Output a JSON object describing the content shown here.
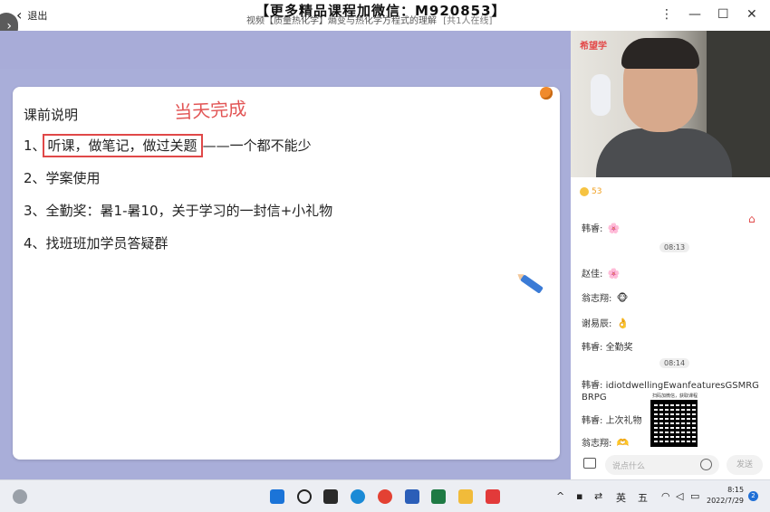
{
  "header": {
    "back_label": "退出",
    "watermark": "【更多精品课程加微信：M920853】",
    "title": "视频【质量热化学】熵变与热化学方程式的理解",
    "online": "[共1人在线]"
  },
  "board": {
    "heading": "课前说明",
    "handwriting": "当天完成",
    "items": [
      {
        "num": "1、",
        "highlight": "听课，做笔记，做过关题",
        "rest": "——一个都不能少"
      },
      {
        "num": "2、",
        "text": "学案使用"
      },
      {
        "num": "3、",
        "text": "全勤奖：暑1-暑10，关于学习的一封信+小礼物"
      },
      {
        "num": "4、",
        "text": "找班班加学员答疑群"
      }
    ]
  },
  "video": {
    "logo": "希望学"
  },
  "likes": "53",
  "chat": {
    "messages": [
      {
        "name": "韩睿:",
        "text": "🌸"
      },
      {
        "time": "08:13"
      },
      {
        "name": "赵佳:",
        "text": "🌸"
      },
      {
        "name": "翁志翔:",
        "text": "🐵"
      },
      {
        "name": "谢易辰:",
        "text": "👌"
      },
      {
        "name": "韩睿:",
        "text": "全勤奖"
      },
      {
        "time": "08:14"
      },
      {
        "name": "韩睿:",
        "text": "idiotdwellingEwanfeaturesGSMRGBRPG"
      },
      {
        "name": "韩睿:",
        "text": "上次礼物"
      },
      {
        "name": "翁志翔:",
        "text": "🫶"
      }
    ],
    "qr_caption": "扫码加微信，获取课程",
    "input_placeholder": "说点什么",
    "send_label": "发送"
  },
  "taskbar": {
    "tray_lang": "英",
    "tray_ime": "五",
    "time": "8:15",
    "date": "2022/7/29",
    "notifications": "2"
  }
}
